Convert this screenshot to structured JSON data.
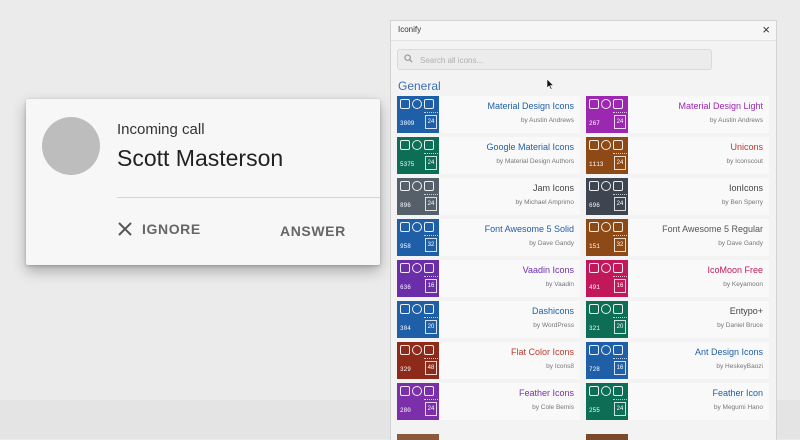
{
  "call": {
    "subtitle": "Incoming call",
    "caller_name": "Scott Masterson",
    "ignore_label": "IGNORE",
    "answer_label": "ANSWER"
  },
  "iconify": {
    "window_title": "Iconify",
    "close_label": "×",
    "search_placeholder": "Search all icons...",
    "section_title": "General",
    "collections": [
      {
        "name": "Material Design Icons",
        "author": "by Austin Andrews",
        "count": "3809",
        "size": "24",
        "tile_color": "#1f5fa8",
        "name_color": "#1f5fa8"
      },
      {
        "name": "Material Design Light",
        "author": "by Austin Andrews",
        "count": "267",
        "size": "24",
        "tile_color": "#9c27b0",
        "name_color": "#9c27b0"
      },
      {
        "name": "Google Material Icons",
        "author": "by Material Design Authors",
        "count": "5375",
        "size": "24",
        "tile_color": "#0b6e55",
        "name_color": "#1f5fa8"
      },
      {
        "name": "Unicons",
        "author": "by Iconscout",
        "count": "1113",
        "size": "24",
        "tile_color": "#8d4a16",
        "name_color": "#c0392b"
      },
      {
        "name": "Jam Icons",
        "author": "by Michael Amprimo",
        "count": "896",
        "size": "24",
        "tile_color": "#56606a",
        "name_color": "#444444"
      },
      {
        "name": "IonIcons",
        "author": "by Ben Sperry",
        "count": "696",
        "size": "24",
        "tile_color": "#3d4550",
        "name_color": "#444444"
      },
      {
        "name": "Font Awesome 5 Solid",
        "author": "by Dave Gandy",
        "count": "958",
        "size": "32",
        "tile_color": "#1f5fa8",
        "name_color": "#1f5fa8"
      },
      {
        "name": "Font Awesome 5 Regular",
        "author": "by Dave Gandy",
        "count": "151",
        "size": "32",
        "tile_color": "#8d4a16",
        "name_color": "#555555"
      },
      {
        "name": "Vaadin Icons",
        "author": "by Vaadin",
        "count": "636",
        "size": "16",
        "tile_color": "#6a2fa8",
        "name_color": "#6a2fa8"
      },
      {
        "name": "IcoMoon Free",
        "author": "by Keyamoon",
        "count": "491",
        "size": "16",
        "tile_color": "#c2185b",
        "name_color": "#c2185b"
      },
      {
        "name": "Dashicons",
        "author": "by WordPress",
        "count": "304",
        "size": "20",
        "tile_color": "#1f5fa8",
        "name_color": "#1f5fa8"
      },
      {
        "name": "Entypo+",
        "author": "by Daniel Bruce",
        "count": "321",
        "size": "20",
        "tile_color": "#0b6e55",
        "name_color": "#444444"
      },
      {
        "name": "Flat Color Icons",
        "author": "by Icons8",
        "count": "329",
        "size": "48",
        "tile_color": "#8d2a1a",
        "name_color": "#c0392b"
      },
      {
        "name": "Ant Design Icons",
        "author": "by HeskeyBaozi",
        "count": "728",
        "size": "16",
        "tile_color": "#1f5fa8",
        "name_color": "#1f5fa8"
      },
      {
        "name": "Feather Icons",
        "author": "by Cole Bemis",
        "count": "280",
        "size": "24",
        "tile_color": "#7b2fa8",
        "name_color": "#7b2fa8"
      },
      {
        "name": "Feather Icon",
        "author": "by Megumi Hano",
        "count": "255",
        "size": "24",
        "tile_color": "#0b6e55",
        "name_color": "#1f5fa8"
      }
    ]
  }
}
